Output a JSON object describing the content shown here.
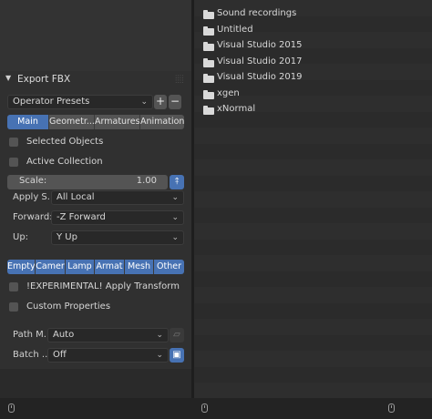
{
  "export_panel": {
    "title": "Export FBX",
    "operator_presets": "Operator Presets",
    "add_preset": "+",
    "remove_preset": "−",
    "tabs": [
      {
        "label": "Main",
        "active": true
      },
      {
        "label": "Geometr...",
        "active": false
      },
      {
        "label": "Armatures",
        "active": false
      },
      {
        "label": "Animation",
        "active": false
      }
    ],
    "selected_objects": "Selected Objects",
    "active_collection": "Active Collection",
    "scale_label": "Scale:",
    "scale_value": "1.00",
    "apply_scalings_label": "Apply S...",
    "apply_scalings_value": "All Local",
    "forward_label": "Forward:",
    "forward_value": "-Z Forward",
    "up_label": "Up:",
    "up_value": "Y Up",
    "object_types": [
      {
        "label": "Empty",
        "active": true
      },
      {
        "label": "Camer",
        "active": true
      },
      {
        "label": "Lamp",
        "active": true
      },
      {
        "label": "Armat",
        "active": true
      },
      {
        "label": "Mesh",
        "active": true
      },
      {
        "label": "Other",
        "active": true
      }
    ],
    "apply_transform": "!EXPERIMENTAL! Apply Transform",
    "custom_properties": "Custom Properties",
    "path_mode_label": "Path M...",
    "path_mode_value": "Auto",
    "batch_mode_label": "Batch ...",
    "batch_mode_value": "Off"
  },
  "file_list": {
    "items": [
      {
        "name": "Sound recordings"
      },
      {
        "name": "Untitled"
      },
      {
        "name": "Visual Studio 2015"
      },
      {
        "name": "Visual Studio 2017"
      },
      {
        "name": "Visual Studio 2019"
      },
      {
        "name": "xgen"
      },
      {
        "name": "xNormal"
      }
    ]
  },
  "icons": {
    "folder": "folder-icon",
    "mouse": "mouse-icon",
    "lock": "lock-icon",
    "embed": "embed-textures-icon",
    "batch_own_dir": "batch-own-dir-icon"
  },
  "colors": {
    "accent": "#4772b3",
    "panel_bg": "#303030",
    "file_list_bg": "#2b2b2b"
  }
}
